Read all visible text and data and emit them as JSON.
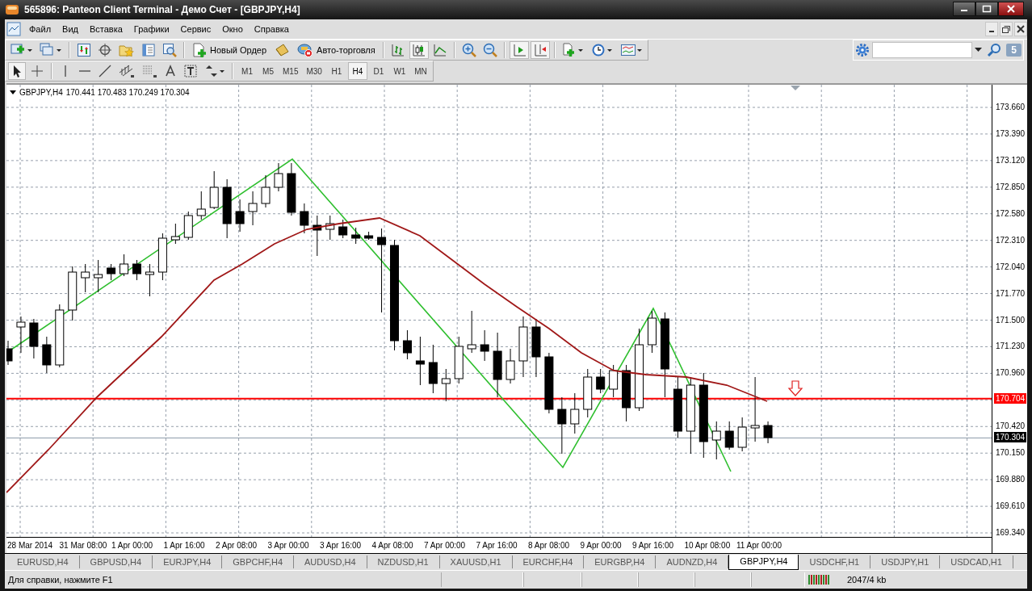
{
  "window": {
    "title": "565896: Panteon Client Terminal - Демо Счет - [GBPJPY,H4]"
  },
  "menu": [
    "Файл",
    "Вид",
    "Вставка",
    "Графики",
    "Сервис",
    "Окно",
    "Справка"
  ],
  "toolbar": {
    "new_order": "Новый Ордер",
    "auto_trading": "Авто-торговля"
  },
  "chart_tools": [
    {
      "kind": "bars",
      "selected": false
    },
    {
      "kind": "candles",
      "selected": true
    },
    {
      "kind": "line",
      "selected": false
    },
    {
      "kind": "autoscroll",
      "selected": true
    },
    {
      "kind": "shift",
      "selected": true
    }
  ],
  "timeframes": [
    {
      "label": "M1",
      "selected": false
    },
    {
      "label": "M5",
      "selected": false
    },
    {
      "label": "M15",
      "selected": false
    },
    {
      "label": "M30",
      "selected": false
    },
    {
      "label": "H1",
      "selected": false
    },
    {
      "label": "H4",
      "selected": true
    },
    {
      "label": "D1",
      "selected": false
    },
    {
      "label": "W1",
      "selected": false
    },
    {
      "label": "MN",
      "selected": false
    }
  ],
  "notification_count": "5",
  "chart": {
    "symbol": "GBPJPY,H4",
    "ohlc": "170.441 170.483 170.249 170.304",
    "price_labels": [
      "173.660",
      "173.390",
      "173.120",
      "172.850",
      "172.580",
      "172.310",
      "172.040",
      "171.770",
      "171.500",
      "171.230",
      "170.960",
      "170.420",
      "170.150",
      "169.880",
      "169.610",
      "169.340"
    ],
    "time_labels": [
      "28 Mar 2014",
      "31 Mar 08:00",
      "1 Apr 00:00",
      "1 Apr 16:00",
      "2 Apr 08:00",
      "3 Apr 00:00",
      "3 Apr 16:00",
      "4 Apr 08:00",
      "7 Apr 00:00",
      "7 Apr 16:00",
      "8 Apr 08:00",
      "9 Apr 00:00",
      "9 Apr 16:00",
      "10 Apr 08:00",
      "11 Apr 00:00"
    ],
    "price_marks": [
      {
        "label": "170.704",
        "kind": "level"
      },
      {
        "label": "170.304",
        "kind": "bid"
      }
    ]
  },
  "tabs": [
    {
      "label": "EURUSD,H4",
      "selected": false
    },
    {
      "label": "GBPUSD,H4",
      "selected": false
    },
    {
      "label": "EURJPY,H4",
      "selected": false
    },
    {
      "label": "GBPCHF,H4",
      "selected": false
    },
    {
      "label": "AUDUSD,H4",
      "selected": false
    },
    {
      "label": "NZDUSD,H1",
      "selected": false
    },
    {
      "label": "XAUUSD,H1",
      "selected": false
    },
    {
      "label": "EURCHF,H4",
      "selected": false
    },
    {
      "label": "EURGBP,H4",
      "selected": false
    },
    {
      "label": "AUDNZD,H4",
      "selected": false
    },
    {
      "label": "GBPJPY,H4",
      "selected": true
    },
    {
      "label": "USDCHF,H1",
      "selected": false
    },
    {
      "label": "USDJPY,H1",
      "selected": false
    },
    {
      "label": "USDCAD,H1",
      "selected": false
    }
  ],
  "status_bar": {
    "help": "Для справки, нажмите F1",
    "traffic": "2047/4 kb"
  }
}
